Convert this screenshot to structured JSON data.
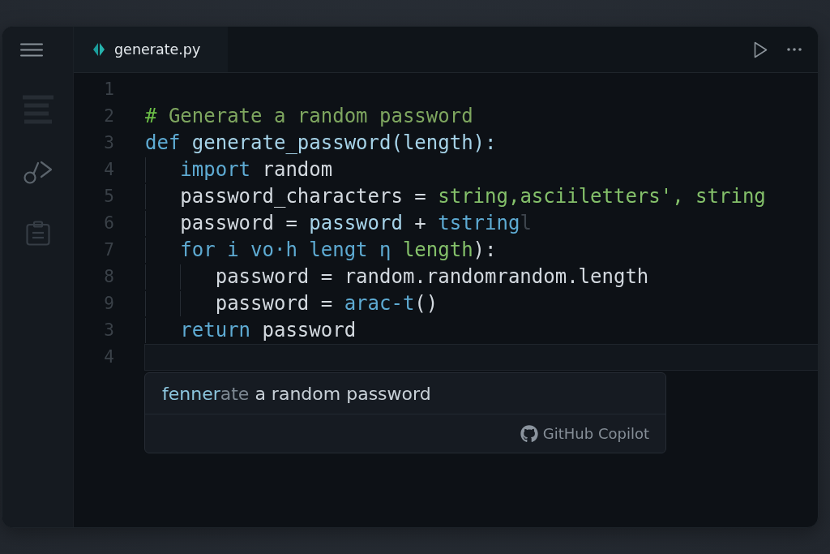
{
  "tabs": [
    {
      "label": "generate.py",
      "selected": true
    }
  ],
  "editor": {
    "lines": [
      {
        "number": "1",
        "current": false
      },
      {
        "number": "2",
        "current": false,
        "tokens": [
          {
            "text": "#",
            "kind": "comment_mark"
          },
          {
            "text": " Generate a random password",
            "kind": "comment"
          }
        ]
      },
      {
        "number": "3",
        "current": false,
        "tokens": [
          {
            "text": "def",
            "kind": "keyword"
          },
          {
            "text": " generate_password(length):",
            "kind": "name"
          }
        ],
        "children": [
          {
            "number": "4",
            "current": false,
            "tokens": [
              {
                "text": "import",
                "kind": "keyword"
              },
              {
                "text": " random",
                "kind": "plain"
              }
            ]
          },
          {
            "number": "5",
            "current": false,
            "tokens": [
              {
                "text": "password_characters = ",
                "kind": "plain"
              },
              {
                "text": "string,asciiletters', string",
                "kind": "string"
              }
            ]
          },
          {
            "number": "6",
            "current": false,
            "tokens": [
              {
                "text": "password = ",
                "kind": "plain"
              },
              {
                "text": "password",
                "kind": "name"
              },
              {
                "text": " + ",
                "kind": "plain"
              },
              {
                "text": "tstring",
                "kind": "keyword"
              },
              {
                "text": "l",
                "kind": "faint"
              }
            ]
          },
          {
            "number": "7",
            "current": false,
            "tokens": [
              {
                "text": "for i vo·h lengt η ",
                "kind": "keyword"
              },
              {
                "text": "length",
                "kind": "string"
              },
              {
                "text": "):",
                "kind": "plain"
              }
            ],
            "children": [
              {
                "number": "8",
                "current": false,
                "tokens": [
                  {
                    "text": "password = random.randomrandom.length",
                    "kind": "plain"
                  }
                ]
              },
              {
                "number": "9",
                "current": false,
                "tokens": [
                  {
                    "text": "password = ",
                    "kind": "plain"
                  },
                  {
                    "text": "arac-t",
                    "kind": "keyword"
                  },
                  {
                    "text": "()",
                    "kind": "plain"
                  }
                ]
              }
            ]
          },
          {
            "number": "3",
            "current": false,
            "tokens": [
              {
                "text": "return",
                "kind": "keyword"
              },
              {
                "text": " password",
                "kind": "plain"
              }
            ]
          }
        ]
      },
      {
        "number": "4",
        "current": true
      }
    ]
  },
  "suggestion": {
    "segments": [
      {
        "text": "fenner",
        "kind": "typed"
      },
      {
        "text": "ate",
        "kind": "ghost"
      },
      {
        "text": " a random password",
        "kind": "plain"
      }
    ],
    "source": "GitHub Copilot"
  }
}
